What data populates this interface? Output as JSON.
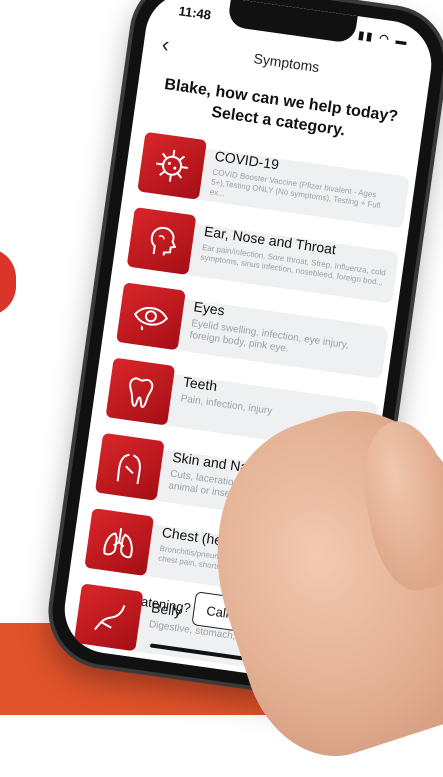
{
  "status_bar": {
    "time": "11:48",
    "icons": "▮▮ ◠ ▬"
  },
  "nav": {
    "back_icon": "‹",
    "title": "Symptoms"
  },
  "greeting": {
    "line1": "Blake, how can we help today?",
    "line2": "Select a category."
  },
  "categories": [
    {
      "title": "COVID-19",
      "icon": "virus-icon",
      "description": "COVID Booster Vaccine (Pfizer bivalent - Ages 5+),Testing ONLY (No symptoms), Testing + Full ex..."
    },
    {
      "title": "Ear, Nose and Throat",
      "icon": "head-profile-icon",
      "description": "Ear pain/infection, Sore throat, Strep, Influenza, cold symptoms, sinus infection, nosebleed, foreign bod..."
    },
    {
      "title": "Eyes",
      "icon": "eye-icon",
      "description": "Eyelid swelling, infection, eye injury, foreign body, pink eye."
    },
    {
      "title": "Teeth",
      "icon": "tooth-icon",
      "description": "Pain, infection, injury"
    },
    {
      "title": "Skin and Nails",
      "icon": "torso-icon",
      "description": "Cuts, lacerations, burns, puncture, boils, animal or insect bites."
    },
    {
      "title": "Chest (heart and lungs)",
      "icon": "lungs-icon",
      "description": "Bronchitis/pneumonia, COVID/Flu, asthma/COPD, chest pain, shortness of breath, heart racing"
    },
    {
      "title": "Belly",
      "icon": "belly-icon",
      "description": "Digestive, stomach, liv"
    }
  ],
  "footer": {
    "label": "Life Threatening?",
    "call_button": "Call 9"
  },
  "colors": {
    "accent": "#d9262a",
    "band": "#e0522a"
  }
}
